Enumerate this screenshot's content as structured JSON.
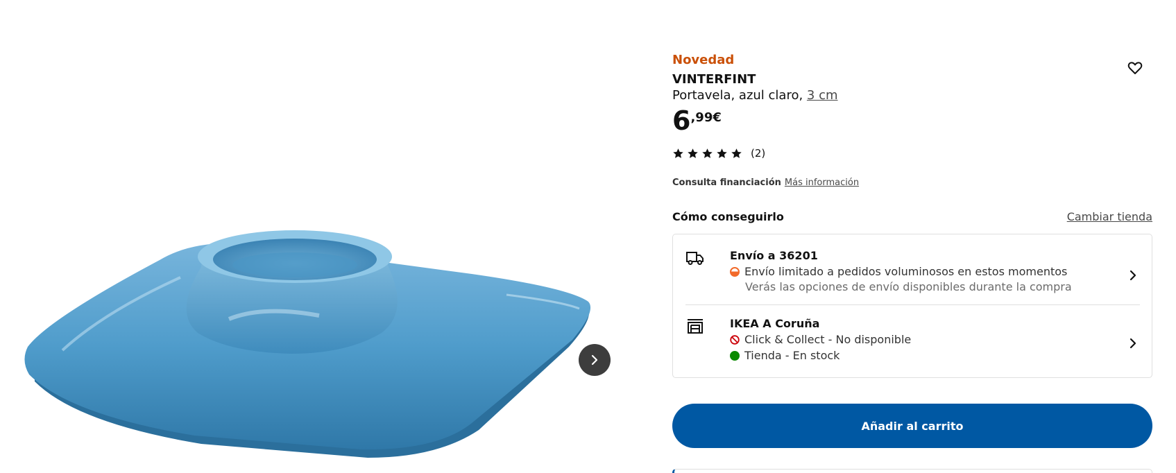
{
  "product": {
    "badge": "Novedad",
    "name": "VINTERFINT",
    "description": "Portavela, azul claro, ",
    "size_link": "3 cm",
    "price_integer": "6",
    "price_decimal": ",99€",
    "rating_value": 5,
    "rating_count": "(2)"
  },
  "financing": {
    "label": "Consulta financiación",
    "link": "Más información"
  },
  "availability": {
    "title": "Cómo conseguirlo",
    "change_store": "Cambiar tienda",
    "delivery": {
      "title": "Envío a 36201",
      "status": "Envío limitado a pedidos voluminosos en estos momentos",
      "note": "Verás las opciones de envío disponibles durante la compra",
      "status_color": "#f26a2a"
    },
    "store": {
      "title": "IKEA A Coruña",
      "click_collect": "Click & Collect - No disponible",
      "in_store": "Tienda - En stock",
      "click_collect_color": "#cc0008",
      "in_store_color": "#0a8a00"
    }
  },
  "cart": {
    "button_label": "Añadir al carrito"
  },
  "colors": {
    "brand_blue": "#0058a3",
    "new_badge": "#ca5008",
    "product_blue": "#4d9cc9"
  },
  "icons": {
    "favorite": "heart-icon",
    "next": "chevron-right-icon",
    "delivery": "truck-icon",
    "store": "store-icon",
    "star": "star-icon"
  }
}
